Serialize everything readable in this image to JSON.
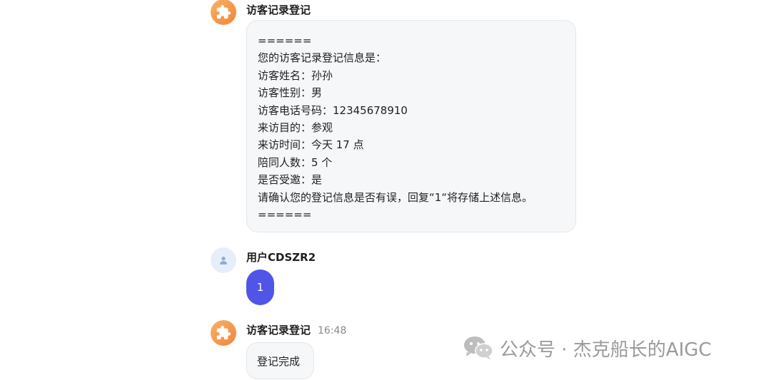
{
  "messages": {
    "bot1": {
      "sender": "访客记录登记",
      "lines": [
        "======",
        "您的访客记录登记信息是：",
        "访客姓名：孙孙",
        "访客性别：男",
        "访客电话号码：12345678910",
        "来访目的：参观",
        "来访时间：今天 17 点",
        "陪同人数：5 个",
        "是否受邀：是",
        "请确认您的登记信息是否有误，回复“1“将存储上述信息。",
        "======"
      ]
    },
    "user": {
      "sender": "用户CDSZR2",
      "text": "1"
    },
    "bot2": {
      "sender": "访客记录登记",
      "time": "16:48",
      "text": "登记完成"
    }
  },
  "watermark": {
    "text": "公众号 · 杰克船长的AIGC",
    "icon": "wechat-icon"
  },
  "colors": {
    "user_bubble": "#4f55e6",
    "bot_avatar": "#f0853a",
    "bubble_bg": "#f6f7f9"
  }
}
